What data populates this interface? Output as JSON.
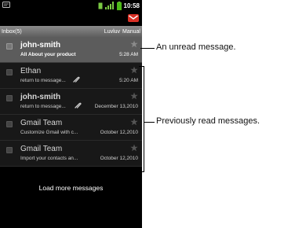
{
  "statusbar": {
    "time": "10:58",
    "icons": [
      "notification-icon",
      "sim-icon",
      "signal-icon",
      "battery-icon"
    ]
  },
  "header": {
    "inbox_label": "Inbox(5)",
    "account_label": "Luvluv",
    "menu_label": "Manual"
  },
  "messages": [
    {
      "sender": "john-smith",
      "snippet": "All About your product",
      "date": "5:28 AM",
      "unread": true,
      "attachment": false
    },
    {
      "sender": "Ethan",
      "snippet": "return to message...",
      "date": "5:20 AM",
      "unread": false,
      "attachment": true
    },
    {
      "sender": "john-smith",
      "snippet": "return to message...",
      "date": "December 13,2010",
      "unread": false,
      "attachment": true
    },
    {
      "sender": "Gmail Team",
      "snippet": "Customize Gmail with c...",
      "date": "October 12,2010",
      "unread": false,
      "attachment": false
    },
    {
      "sender": "Gmail Team",
      "snippet": "Import your contacts an...",
      "date": "October 12,2010",
      "unread": false,
      "attachment": false
    }
  ],
  "load_more_label": "Load more messages",
  "annotations": {
    "unread": "An unread message.",
    "read": "Previously read messages."
  },
  "colors": {
    "unread_row": "#5c5c5c",
    "read_row": "#181818",
    "screen_bg": "#000000",
    "gmail_red": "#d93025",
    "battery_green": "#4cbb17"
  }
}
